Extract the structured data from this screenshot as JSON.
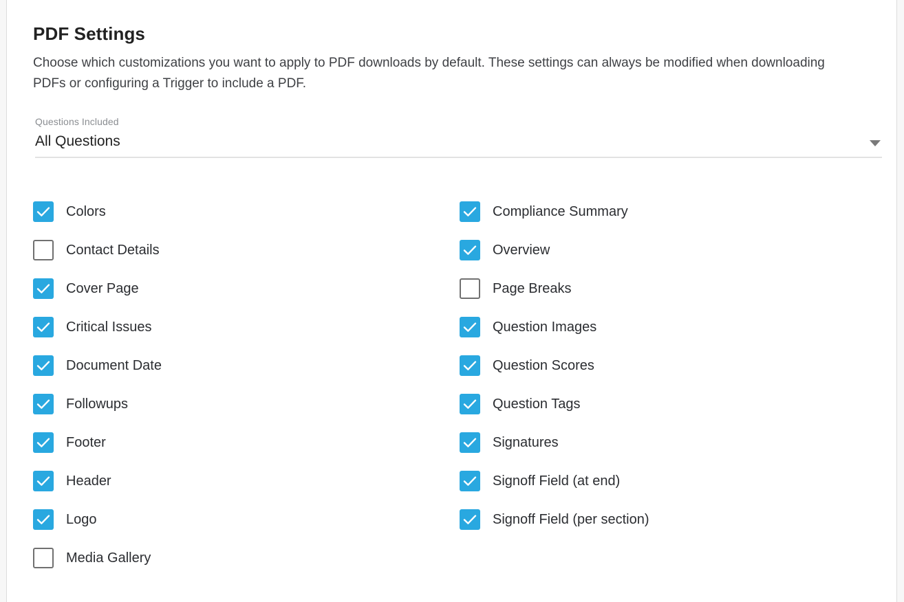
{
  "page": {
    "title": "PDF Settings",
    "description": "Choose which customizations you want to apply to PDF downloads by default. These settings can always be modified when downloading PDFs or configuring a Trigger to include a PDF."
  },
  "questions_field": {
    "label": "Questions Included",
    "value": "All Questions",
    "caret_icon": "chevron-down-icon"
  },
  "colors": {
    "checkbox_checked": "#29a8e0",
    "checkbox_unchecked_border": "#707070",
    "text_primary": "#222222",
    "text_secondary": "#3f4145",
    "label_muted": "#8a8d91",
    "divider": "#e2e2e2"
  },
  "options": {
    "left_column": [
      {
        "label": "Colors",
        "checked": true
      },
      {
        "label": "Contact Details",
        "checked": false
      },
      {
        "label": "Cover Page",
        "checked": true
      },
      {
        "label": "Critical Issues",
        "checked": true
      },
      {
        "label": "Document Date",
        "checked": true
      },
      {
        "label": "Followups",
        "checked": true
      },
      {
        "label": "Footer",
        "checked": true
      },
      {
        "label": "Header",
        "checked": true
      },
      {
        "label": "Logo",
        "checked": true
      },
      {
        "label": "Media Gallery",
        "checked": false
      }
    ],
    "right_column": [
      {
        "label": "Compliance Summary",
        "checked": true
      },
      {
        "label": "Overview",
        "checked": true
      },
      {
        "label": "Page Breaks",
        "checked": false
      },
      {
        "label": "Question Images",
        "checked": true
      },
      {
        "label": "Question Scores",
        "checked": true
      },
      {
        "label": "Question Tags",
        "checked": true
      },
      {
        "label": "Signatures",
        "checked": true
      },
      {
        "label": "Signoff Field (at end)",
        "checked": true
      },
      {
        "label": "Signoff Field (per section)",
        "checked": true
      }
    ]
  }
}
